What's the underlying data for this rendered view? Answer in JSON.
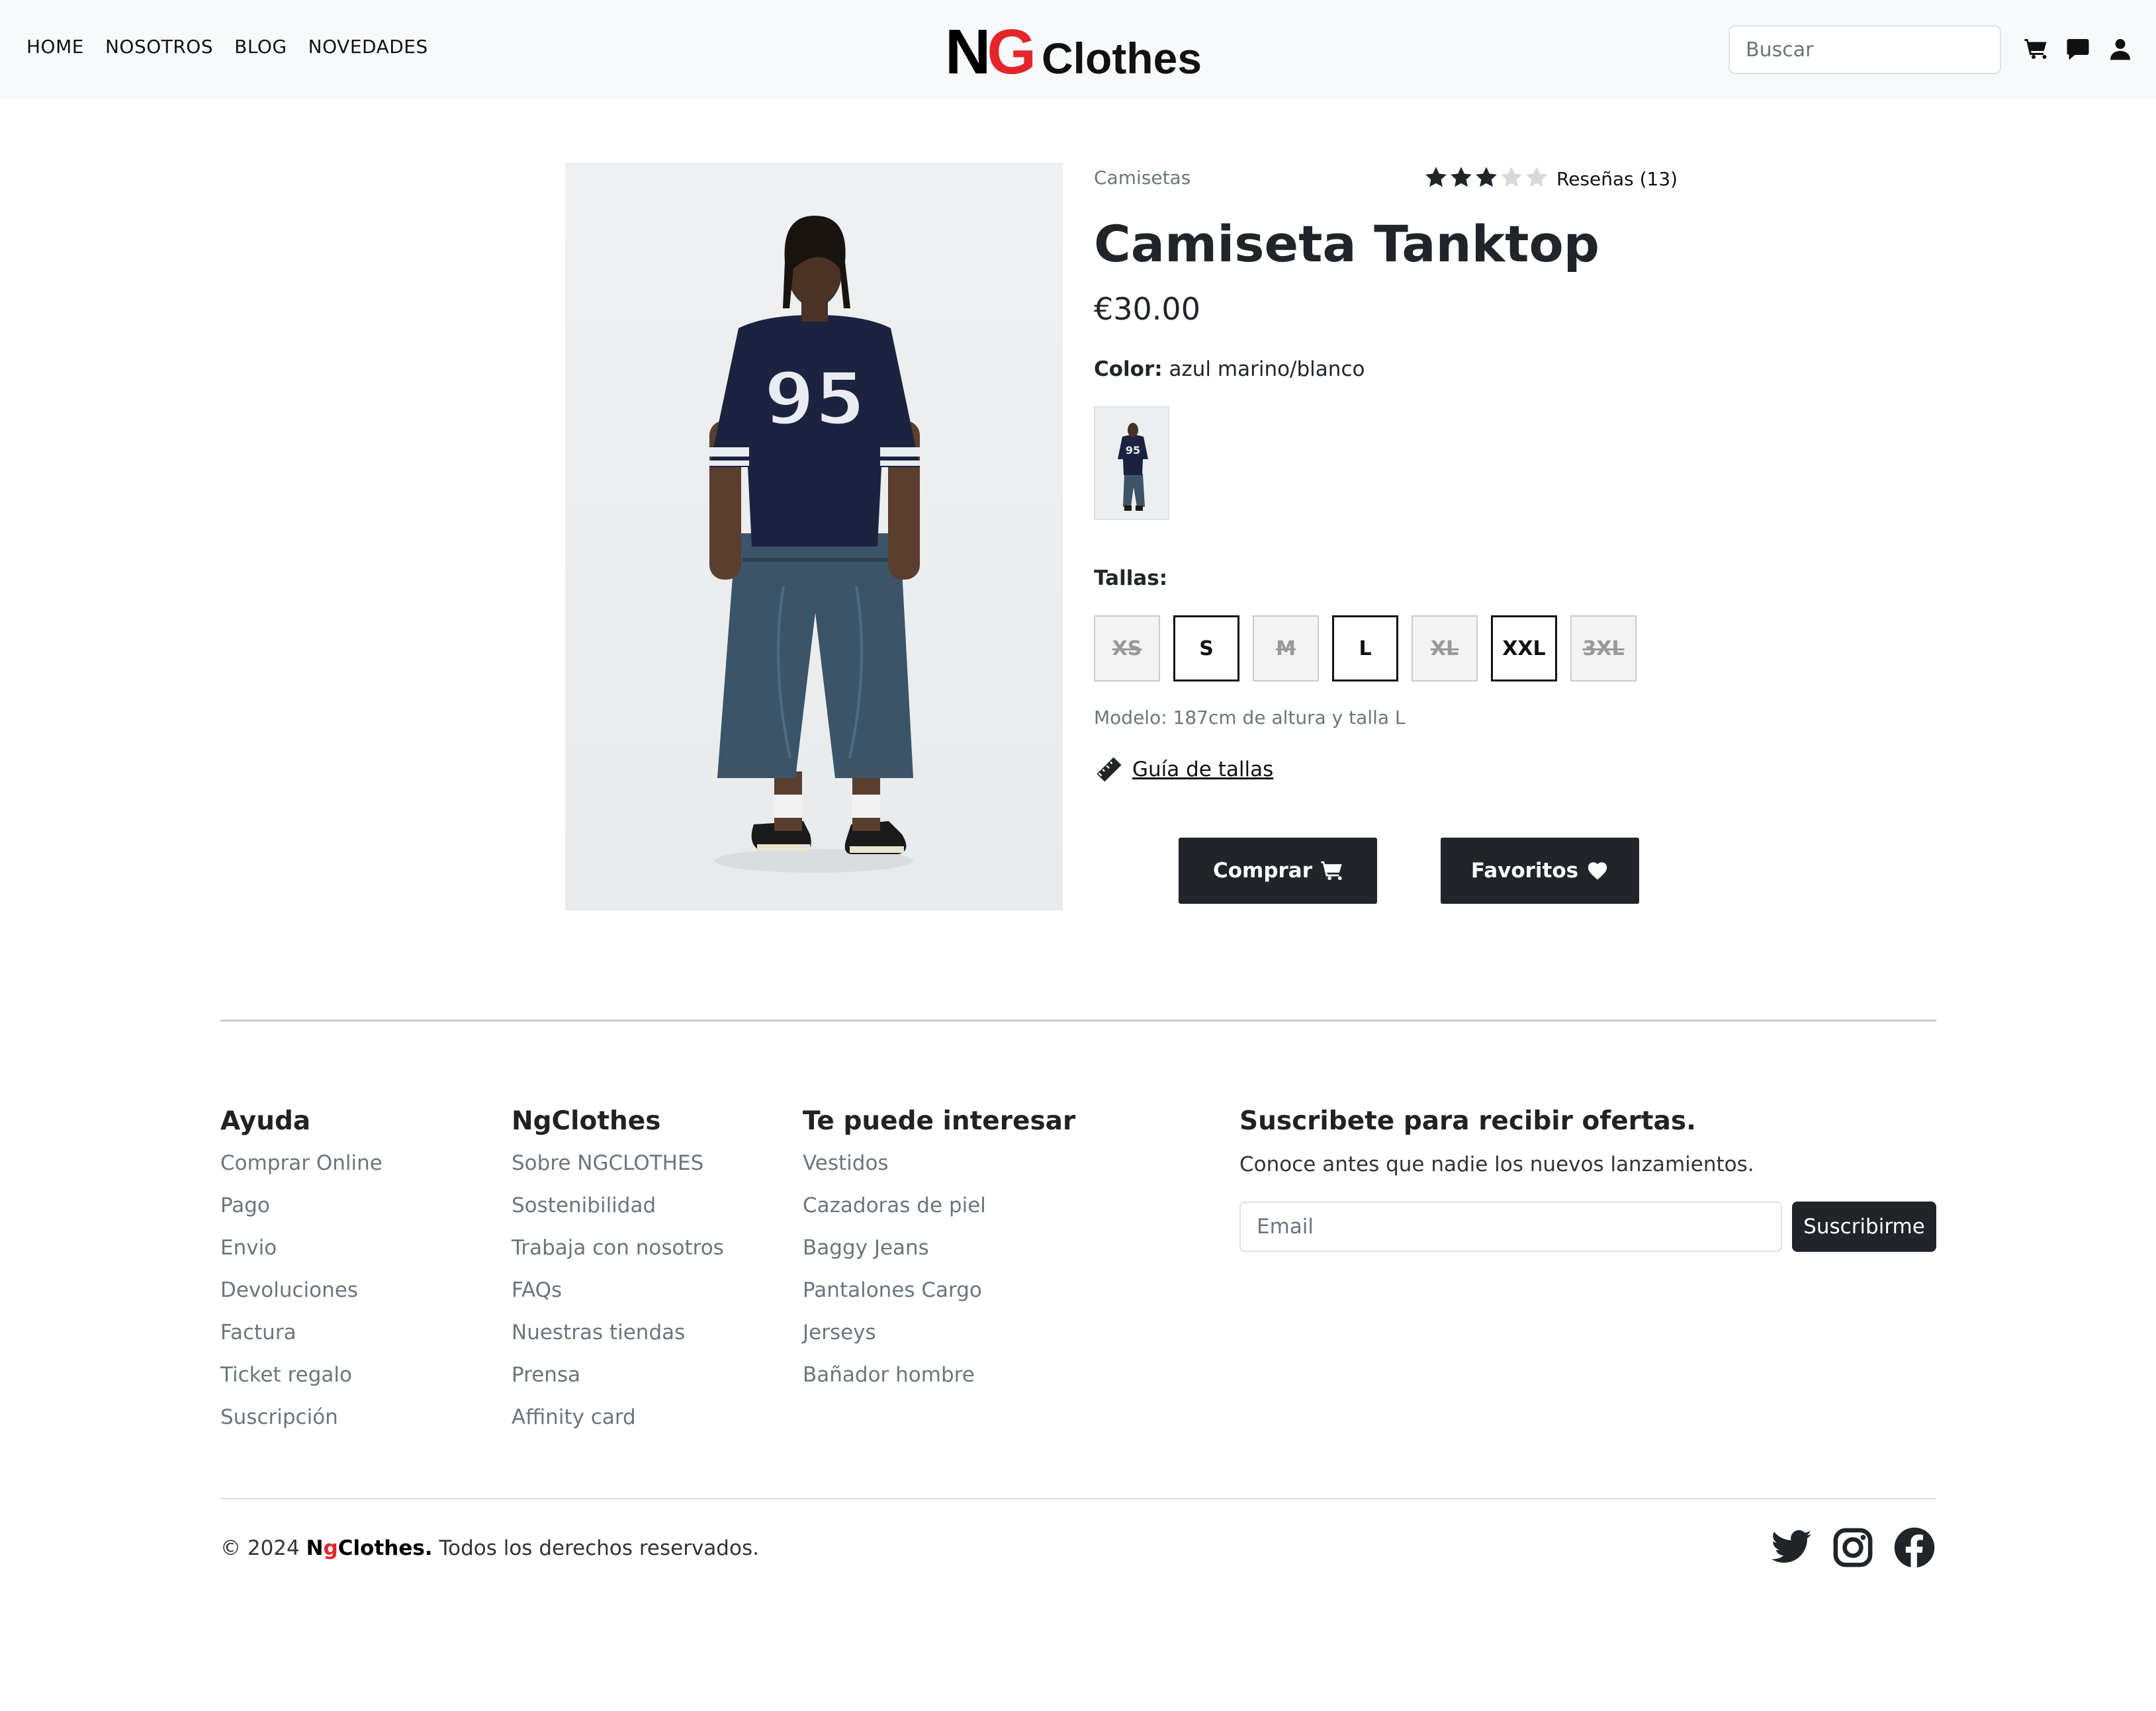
{
  "header": {
    "nav": [
      "HOME",
      "NOSOTROS",
      "BLOG",
      "NOVEDADES"
    ],
    "logo": {
      "part1": "N",
      "part2": "G",
      "part3": "Clothes"
    },
    "search_placeholder": "Buscar",
    "icons": [
      "cart-icon",
      "chat-icon",
      "user-icon"
    ]
  },
  "product": {
    "category": "Camisetas",
    "rating": 3,
    "rating_max": 5,
    "reviews_label": "Reseñas (13)",
    "title": "Camiseta Tanktop",
    "price": "€30.00",
    "color_label": "Color:",
    "color_value": " azul marino/blanco",
    "jersey_number": "95",
    "sizes_label": "Tallas:",
    "sizes": [
      {
        "label": "XS",
        "available": false
      },
      {
        "label": "S",
        "available": true
      },
      {
        "label": "M",
        "available": false
      },
      {
        "label": "L",
        "available": true
      },
      {
        "label": "XL",
        "available": false
      },
      {
        "label": "XXL",
        "available": true
      },
      {
        "label": "3XL",
        "available": false
      }
    ],
    "model_note": "Modelo: 187cm de altura y talla L",
    "size_guide": "Guía de tallas",
    "buy_label": "Comprar",
    "fav_label": "Favoritos"
  },
  "footer": {
    "columns": [
      {
        "title": "Ayuda",
        "items": [
          "Comprar Online",
          "Pago",
          "Envio",
          "Devoluciones",
          "Factura",
          "Ticket regalo",
          "Suscripción"
        ]
      },
      {
        "title": "NgClothes",
        "items": [
          "Sobre NGCLOTHES",
          "Sostenibilidad",
          "Trabaja con nosotros",
          "FAQs",
          "Nuestras tiendas",
          "Prensa",
          "Affinity card"
        ]
      },
      {
        "title": "Te puede interesar",
        "items": [
          "Vestidos",
          "Cazadoras de piel",
          "Baggy Jeans",
          "Pantalones Cargo",
          "Jerseys",
          "Bañador hombre"
        ]
      }
    ],
    "subscribe": {
      "title": "Suscribete para recibir ofertas.",
      "description": "Conoce antes que nadie los nuevos lanzamientos.",
      "email_placeholder": "Email",
      "button": "Suscribirme"
    },
    "copyright": {
      "prefix": "© 2024 ",
      "brand_n": "N",
      "brand_g": "g",
      "brand_rest": "Clothes.",
      "suffix": " Todos los derechos reservados."
    },
    "social": [
      "twitter-icon",
      "instagram-icon",
      "facebook-icon"
    ]
  },
  "colors": {
    "accent": "#e4262b",
    "dark": "#212529",
    "navy": "#1c2340"
  }
}
